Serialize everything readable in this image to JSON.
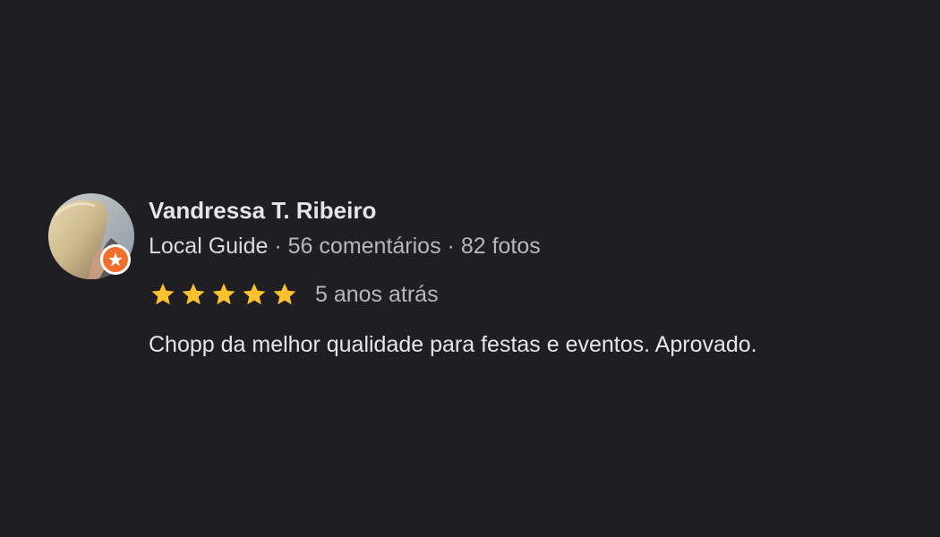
{
  "review": {
    "author": {
      "name": "Vandressa T. Ribeiro",
      "level": "Local Guide",
      "reviews_count": "56 comentários",
      "photos_count": "82 fotos",
      "separator": " · "
    },
    "rating": {
      "stars": 5,
      "max": 5,
      "star_color": "#fbc02d"
    },
    "time_ago": "5 anos atrás",
    "text": "Chopp da melhor qualidade para festas e eventos. Aprovado."
  },
  "colors": {
    "background": "#1f1f23",
    "guide_badge": "#f06f2d"
  },
  "icons": {
    "badge": "local-guide-star-icon",
    "rating": "star-icon"
  }
}
